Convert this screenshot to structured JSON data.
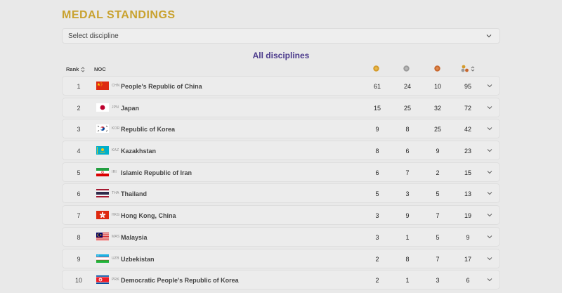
{
  "title": "MEDAL STANDINGS",
  "select": {
    "value": "Select discipline"
  },
  "subtitle": "All disciplines",
  "columns": {
    "rank": "Rank",
    "noc": "NOC"
  },
  "colors": {
    "title": "#c9a22f",
    "subtitle": "#4b3a8c",
    "gold": "#d49a2a",
    "silver": "#9a9a9a",
    "bronze": "#c8662c"
  },
  "icons": {
    "select": "chevron-down-icon",
    "sort": "sort-icon",
    "expand": "chevron-down-icon",
    "gold": "gold-medal-icon",
    "silver": "silver-medal-icon",
    "bronze": "bronze-medal-icon",
    "total": "total-medals-icon"
  },
  "rows": [
    {
      "rank": "1",
      "code": "CHN",
      "name": "People's Republic of China",
      "flag": "chn",
      "gold": "61",
      "silver": "24",
      "bronze": "10",
      "total": "95"
    },
    {
      "rank": "2",
      "code": "JPN",
      "name": "Japan",
      "flag": "jpn",
      "gold": "15",
      "silver": "25",
      "bronze": "32",
      "total": "72"
    },
    {
      "rank": "3",
      "code": "KOR",
      "name": "Republic of Korea",
      "flag": "kor",
      "gold": "9",
      "silver": "8",
      "bronze": "25",
      "total": "42"
    },
    {
      "rank": "4",
      "code": "KAZ",
      "name": "Kazakhstan",
      "flag": "kaz",
      "gold": "8",
      "silver": "6",
      "bronze": "9",
      "total": "23"
    },
    {
      "rank": "5",
      "code": "IRI",
      "name": "Islamic Republic of Iran",
      "flag": "iri",
      "gold": "6",
      "silver": "7",
      "bronze": "2",
      "total": "15"
    },
    {
      "rank": "6",
      "code": "THA",
      "name": "Thailand",
      "flag": "tha",
      "gold": "5",
      "silver": "3",
      "bronze": "5",
      "total": "13"
    },
    {
      "rank": "7",
      "code": "HKG",
      "name": "Hong Kong, China",
      "flag": "hkg",
      "gold": "3",
      "silver": "9",
      "bronze": "7",
      "total": "19"
    },
    {
      "rank": "8",
      "code": "MAS",
      "name": "Malaysia",
      "flag": "mas",
      "gold": "3",
      "silver": "1",
      "bronze": "5",
      "total": "9"
    },
    {
      "rank": "9",
      "code": "UZB",
      "name": "Uzbekistan",
      "flag": "uzb",
      "gold": "2",
      "silver": "8",
      "bronze": "7",
      "total": "17"
    },
    {
      "rank": "10",
      "code": "PRK",
      "name": "Democratic People's Republic of Korea",
      "flag": "prk",
      "gold": "2",
      "silver": "1",
      "bronze": "3",
      "total": "6"
    }
  ]
}
